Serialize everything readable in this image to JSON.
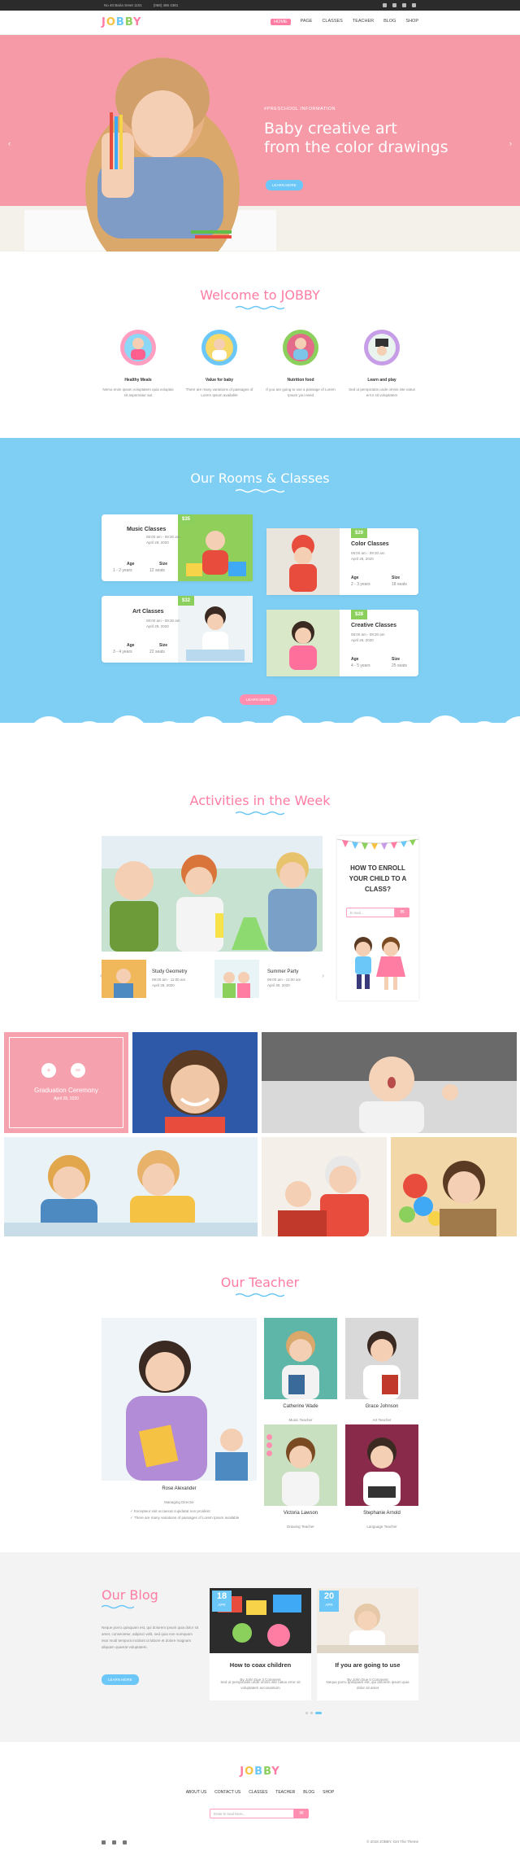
{
  "topbar": {
    "address": "No 40 Baria Sreet 1101",
    "phone": "(068) 486 4381"
  },
  "nav": {
    "logo": [
      "J",
      "O",
      "B",
      "B",
      "Y"
    ],
    "menu": [
      "HOME",
      "PAGE",
      "CLASSES",
      "TEACHER",
      "BLOG",
      "SHOP"
    ]
  },
  "hero": {
    "kicker": "#PRESCHOOL INFORMATION",
    "line1": "Baby creative art",
    "line2": "from the color drawings",
    "button": "LEARN MORE"
  },
  "welcome": {
    "title": "Welcome to JOBBY",
    "features": [
      {
        "title": "Healthy Meals",
        "text": "Nemo enim ipsam voluptatem quia voluptas sit aspernatur aut"
      },
      {
        "title": "Value for baby",
        "text": "There are many variations of passages of Lorem Ipsum available"
      },
      {
        "title": "Nutrition food",
        "text": "If you are going to use a passage of Lorem Ipsum you need"
      },
      {
        "title": "Learn and play",
        "text": "Sed ut perspiciatis unde omnis iste natus error sit voluptatem"
      }
    ]
  },
  "rooms": {
    "title": "Our Rooms & Classes",
    "button": "LEARN MORE",
    "age_label": "Age",
    "size_label": "Size",
    "classes": [
      {
        "name": "Music Classes",
        "time": "08:00 am - 09:30 am",
        "date": "April 28, 2020",
        "age": "1 - 2 years",
        "size": "12 seats",
        "price": "$35"
      },
      {
        "name": "Color Classes",
        "time": "08:00 am - 09:30 am",
        "date": "April 28, 2020",
        "age": "2 - 3 years",
        "size": "18 seats",
        "price": "$29"
      },
      {
        "name": "Art Classes",
        "time": "08:00 am - 09:30 am",
        "date": "April 29, 2020",
        "age": "3 - 4 years",
        "size": "22 seats",
        "price": "$32"
      },
      {
        "name": "Creative Classes",
        "time": "08:00 am - 09:30 am",
        "date": "April 28, 2020",
        "age": "4 - 5 years",
        "size": "25 seats",
        "price": "$28"
      }
    ]
  },
  "activities": {
    "title": "Activities in the Week",
    "events": [
      {
        "name": "Study Geometry",
        "time": "09:00 am - 11:00 am",
        "date": "April 28, 2020"
      },
      {
        "name": "Summer Party",
        "time": "09:00 am - 11:00 am",
        "date": "April 30, 2020"
      }
    ],
    "enroll": {
      "line1": "HOW TO ENROLL",
      "line2": "YOUR CHILD TO A",
      "line3": "CLASS?",
      "placeholder": "E-mail..."
    }
  },
  "gallery": {
    "title": "Graduation Ceremony",
    "date": "April 28, 2020"
  },
  "teacher": {
    "title": "Our Teacher",
    "main": {
      "name": "Rose Alexander",
      "role": "Managing Director"
    },
    "bullets": [
      "Excepteur sint occaecat cupidatat non proident",
      "There are many variations of passages of Lorem Ipsum available"
    ],
    "others": [
      {
        "name": "Catherine Wade",
        "role": "Music Teacher"
      },
      {
        "name": "Grace Johnson",
        "role": "Art Teacher"
      },
      {
        "name": "Victoria Lawson",
        "role": "Drawing Teacher"
      },
      {
        "name": "Stephanie Arnold",
        "role": "Language Teacher"
      }
    ]
  },
  "blog": {
    "title": "Our Blog",
    "intro": "Neque porro quisquam est, qui dolorem ipsum quia dolor sit amet, consectetur, adipisci velit, sed quia non numquam eius modi tempora incidunt ut labore et dolore magnam aliquam quaerat voluptatem.",
    "button": "LEARN MORE",
    "posts": [
      {
        "day": "18",
        "mon": "APR",
        "title": "How to coax children",
        "meta": "By John Due   3 Comment",
        "text": "Sed ut perspiciatis unde omnis iste natus error sit voluptatem accusantium"
      },
      {
        "day": "20",
        "mon": "APR",
        "title": "If you are going to use",
        "meta": "By John Due   0 Comment",
        "text": "Neque porro quisquam est, qui dolorem ipsum quia dolor sit amet"
      }
    ]
  },
  "footer": {
    "menu": [
      "ABOUT US",
      "CONTACT US",
      "CLASSES",
      "TEACHER",
      "BLOG",
      "SHOP"
    ],
    "placeholder": "Enter E-mail Here...",
    "copyright": "© 2018 JOBBY. Get The Theme"
  },
  "colors": {
    "pink": "#ff7ca3",
    "blue": "#6ac7f7",
    "green": "#8bd05c",
    "yellow": "#f6c244"
  }
}
